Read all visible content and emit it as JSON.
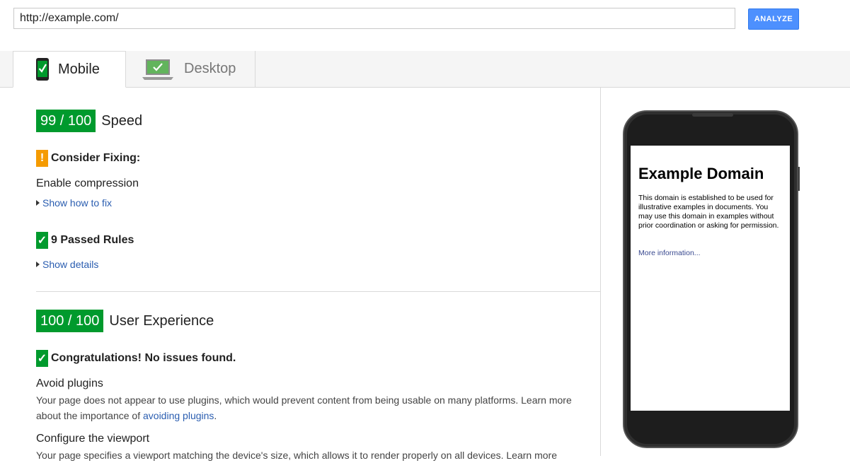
{
  "url_bar": {
    "value": "http://example.com/",
    "analyze_label": "ANALYZE"
  },
  "tabs": [
    {
      "label": "Mobile",
      "selected": true
    },
    {
      "label": "Desktop",
      "selected": false
    }
  ],
  "speed": {
    "score": "99 / 100",
    "label": "Speed",
    "consider_fixing": "Consider Fixing:",
    "rule": "Enable compression",
    "show_how": "Show how to fix",
    "passed": "9 Passed Rules",
    "show_details": "Show details"
  },
  "ux": {
    "score": "100 / 100",
    "label": "User Experience",
    "congrats": "Congratulations! No issues found.",
    "rule1_title": "Avoid plugins",
    "rule1_text": "Your page does not appear to use plugins, which would prevent content from being usable on many platforms. Learn more about the importance of ",
    "rule1_link": "avoiding plugins",
    "rule1_end": ".",
    "rule2_title": "Configure the viewport",
    "rule2_text": "Your page specifies a viewport matching the device's size, which allows it to render properly on all devices. Learn more"
  },
  "preview": {
    "heading": "Example Domain",
    "body": "This domain is established to be used for illustrative examples in documents. You may use this domain in examples without prior coordination or asking for permission.",
    "link": "More information..."
  },
  "icons": {
    "warn": "!",
    "check": "✓"
  },
  "colors": {
    "score_green": "#009a2d",
    "warning_orange": "#f59b00",
    "link_blue": "#2a5db0",
    "button_blue": "#4d90fe"
  }
}
